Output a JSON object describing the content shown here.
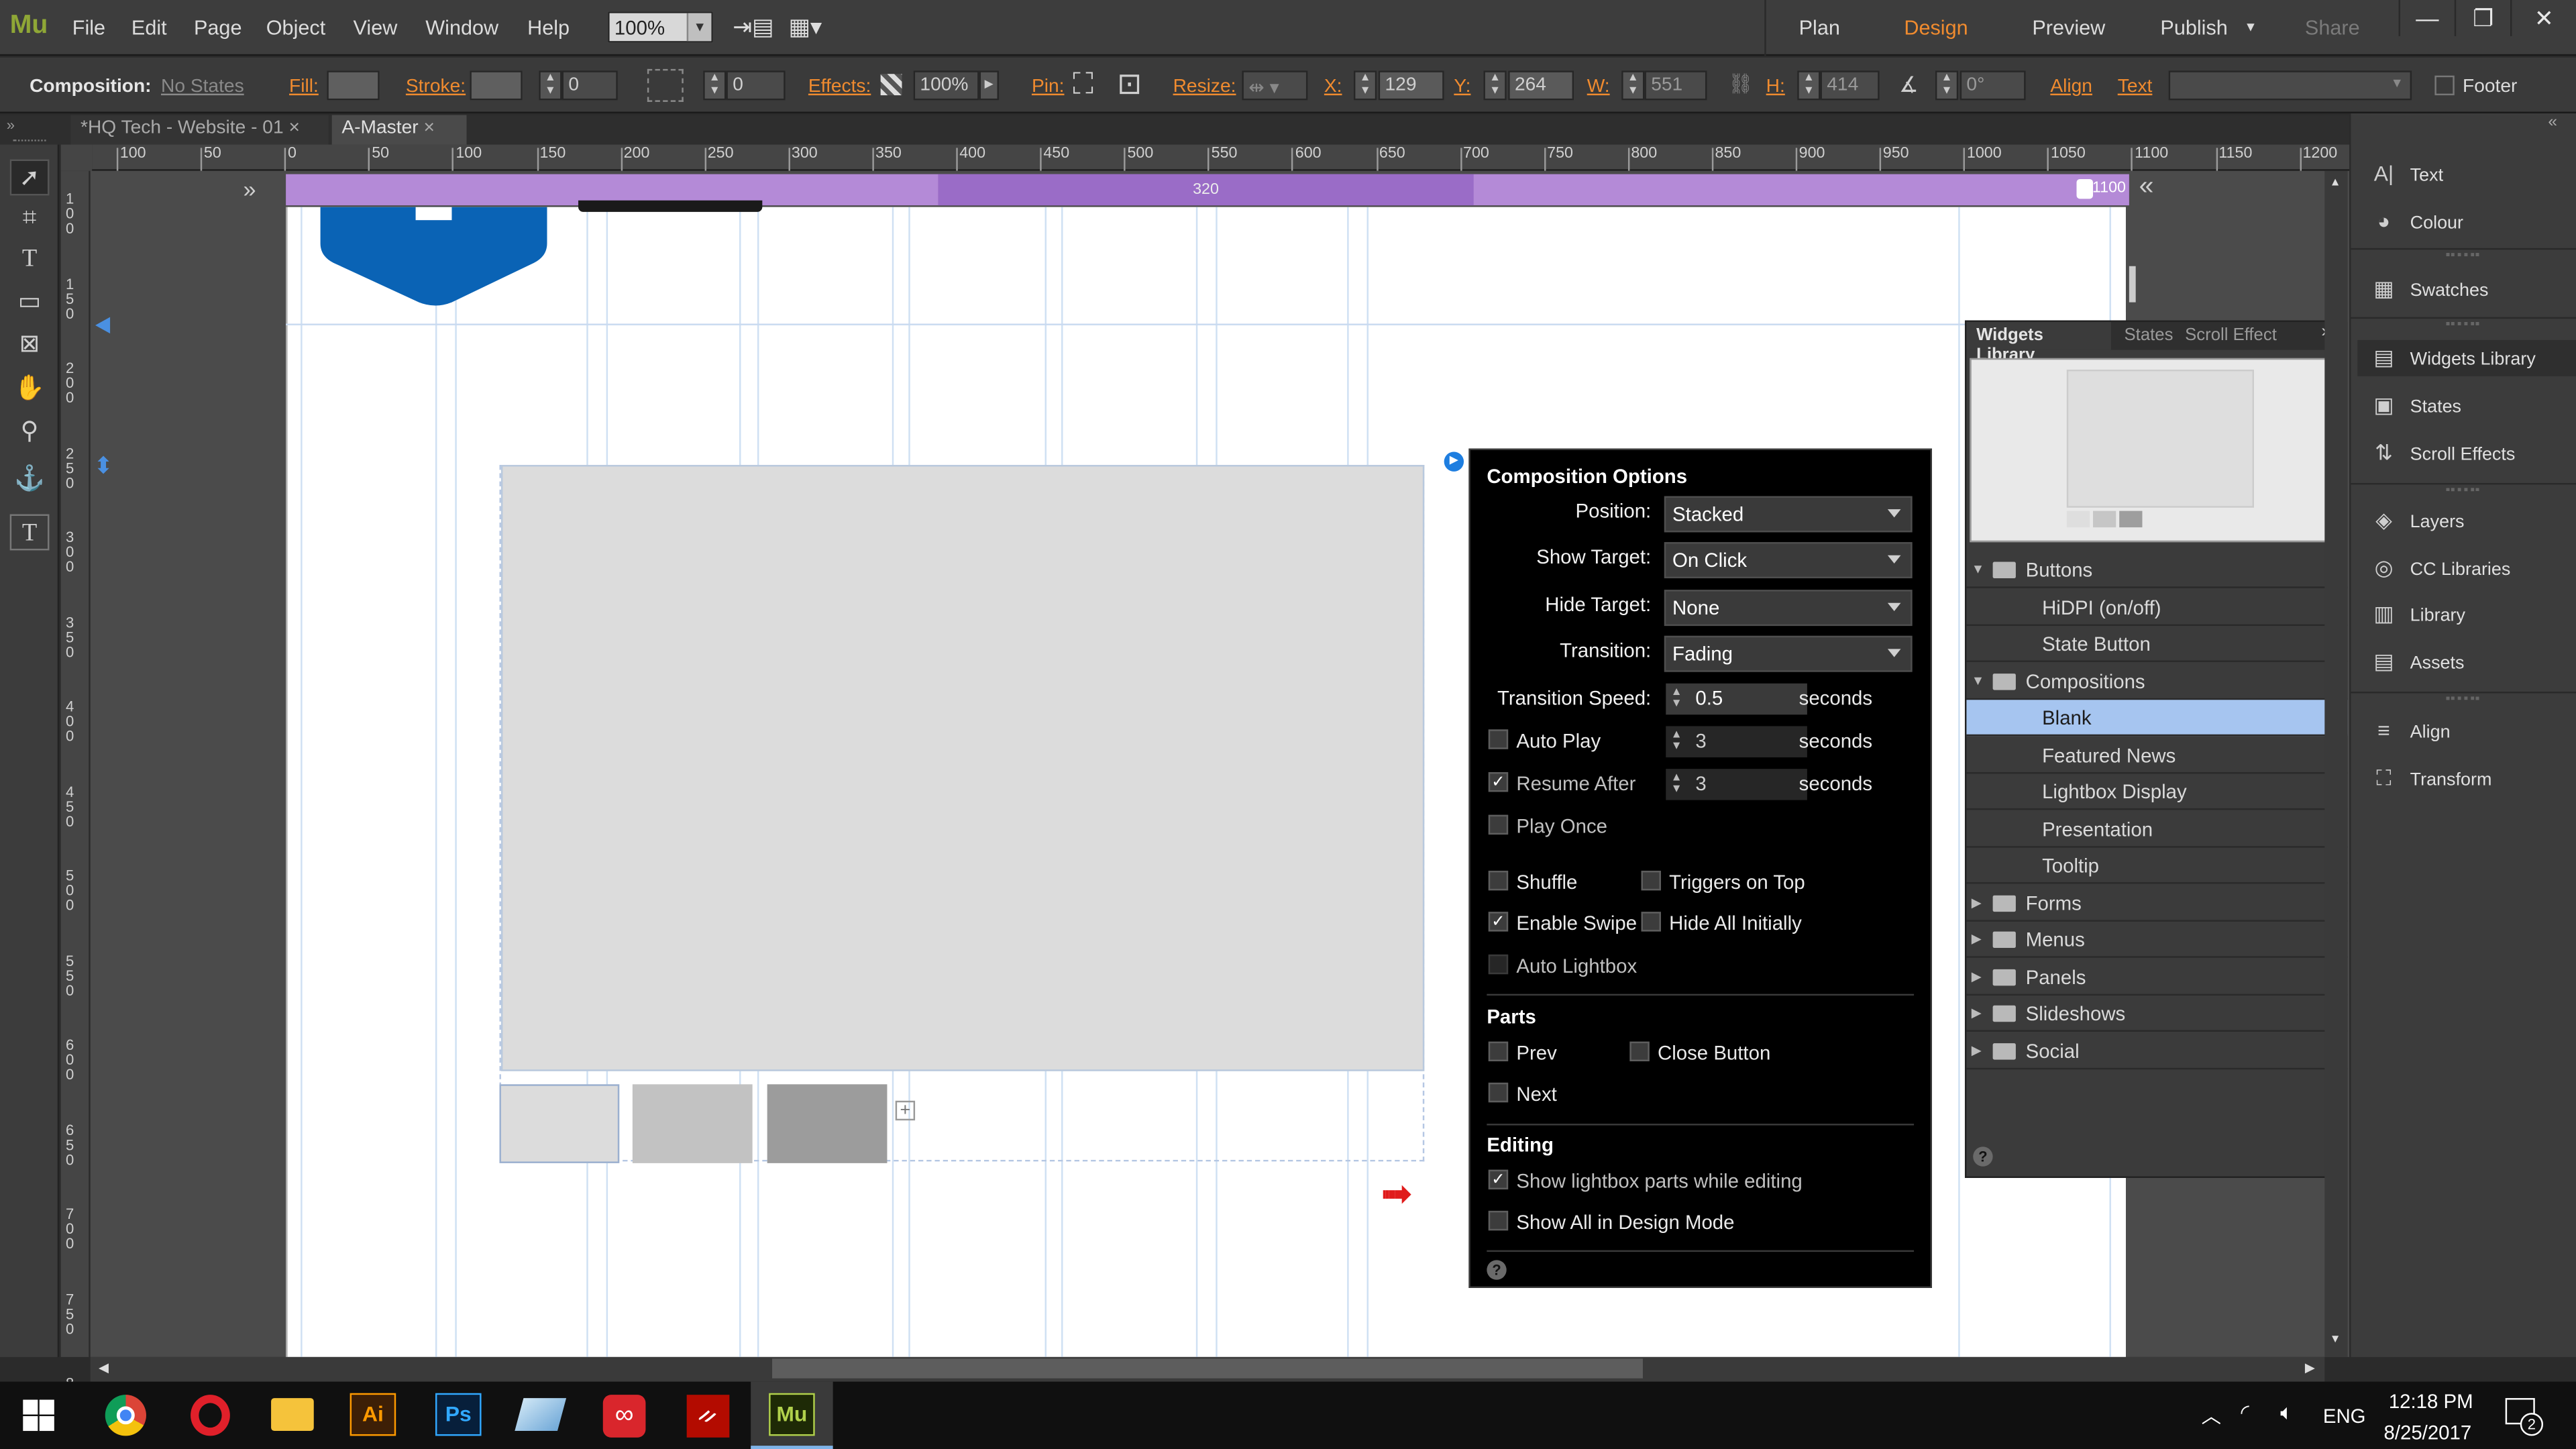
{
  "app": {
    "logo": "Mu"
  },
  "menu": [
    "File",
    "Edit",
    "Page",
    "Object",
    "View",
    "Window",
    "Help"
  ],
  "zoom": "100%",
  "nav": {
    "plan": "Plan",
    "design": "Design",
    "preview": "Preview",
    "publish": "Publish",
    "share": "Share"
  },
  "options": {
    "composition_label": "Composition:",
    "composition_value": "No States",
    "fill": "Fill:",
    "stroke": "Stroke:",
    "stroke_value": "0",
    "corner_value": "0",
    "effects": "Effects:",
    "opacity": "100%",
    "pin": "Pin:",
    "resize": "Resize:",
    "x_label": "X:",
    "x_value": "129",
    "y_label": "Y:",
    "y_value": "264",
    "w_label": "W:",
    "w_value": "551",
    "h_label": "H:",
    "h_value": "414",
    "rot_value": "0°",
    "align": "Align",
    "text": "Text",
    "footer": "Footer"
  },
  "tabs": [
    {
      "label": "*HQ Tech - Website - 01"
    },
    {
      "label": "A-Master"
    }
  ],
  "ruler_h": [
    "100",
    "50",
    "0",
    "50",
    "100",
    "150",
    "200",
    "250",
    "300",
    "350",
    "400",
    "450",
    "500",
    "550",
    "600",
    "650",
    "700",
    "750",
    "800",
    "850",
    "900",
    "950",
    "1000",
    "1050",
    "1100",
    "1150",
    "1200"
  ],
  "ruler_v": [
    "1 0 0",
    "1 5 0",
    "2 0 0",
    "2 5 0",
    "3 0 0",
    "3 5 0",
    "4 0 0",
    "4 5 0",
    "5 0 0",
    "5 5 0",
    "6 0 0",
    "6 5 0",
    "7 0 0",
    "7 5 0",
    "8"
  ],
  "breakpoint": {
    "mid": "320",
    "max": "1100"
  },
  "composition_options": {
    "title": "Composition Options",
    "position_label": "Position:",
    "position_value": "Stacked",
    "show_target_label": "Show Target:",
    "show_target_value": "On Click",
    "hide_target_label": "Hide Target:",
    "hide_target_value": "None",
    "transition_label": "Transition:",
    "transition_value": "Fading",
    "speed_label": "Transition Speed:",
    "speed_value": "0.5",
    "seconds": "seconds",
    "autoplay_label": "Auto Play",
    "autoplay_value": "3",
    "resume_label": "Resume After",
    "resume_value": "3",
    "play_once": "Play Once",
    "shuffle": "Shuffle",
    "triggers_on_top": "Triggers on Top",
    "enable_swipe": "Enable Swipe",
    "hide_all": "Hide All Initially",
    "auto_lightbox": "Auto Lightbox",
    "parts_title": "Parts",
    "prev": "Prev",
    "close_button": "Close Button",
    "next": "Next",
    "editing_title": "Editing",
    "show_lightbox_parts": "Show lightbox parts while editing",
    "show_all_design": "Show All in Design Mode"
  },
  "widgets_library": {
    "tabs": [
      "Widgets Library",
      "States",
      "Scroll Effect"
    ],
    "rows": [
      {
        "label": "Buttons",
        "kind": "folder-open"
      },
      {
        "label": "HiDPI (on/off)",
        "kind": "item"
      },
      {
        "label": "State Button",
        "kind": "item"
      },
      {
        "label": "Compositions",
        "kind": "folder-open"
      },
      {
        "label": "Blank",
        "kind": "item-selected"
      },
      {
        "label": "Featured News",
        "kind": "item"
      },
      {
        "label": "Lightbox Display",
        "kind": "item"
      },
      {
        "label": "Presentation",
        "kind": "item"
      },
      {
        "label": "Tooltip",
        "kind": "item"
      },
      {
        "label": "Forms",
        "kind": "folder"
      },
      {
        "label": "Menus",
        "kind": "folder"
      },
      {
        "label": "Panels",
        "kind": "folder"
      },
      {
        "label": "Slideshows",
        "kind": "folder"
      },
      {
        "label": "Social",
        "kind": "folder"
      }
    ]
  },
  "right_panels": [
    "Text",
    "Colour",
    "Swatches",
    "Widgets Library",
    "States",
    "Scroll Effects",
    "Layers",
    "CC Libraries",
    "Library",
    "Assets",
    "Align",
    "Transform"
  ],
  "taskbar": {
    "apps": [
      "Ai",
      "Ps",
      "Mu"
    ],
    "lang": "ENG",
    "time": "12:18 PM",
    "date": "8/25/2017",
    "notif": "2"
  },
  "colors": {
    "accent": "#f08b2f",
    "breakpoint": "#b48ad7",
    "selection": "#a6c5f0",
    "logo_blue": "#0a63b5"
  }
}
